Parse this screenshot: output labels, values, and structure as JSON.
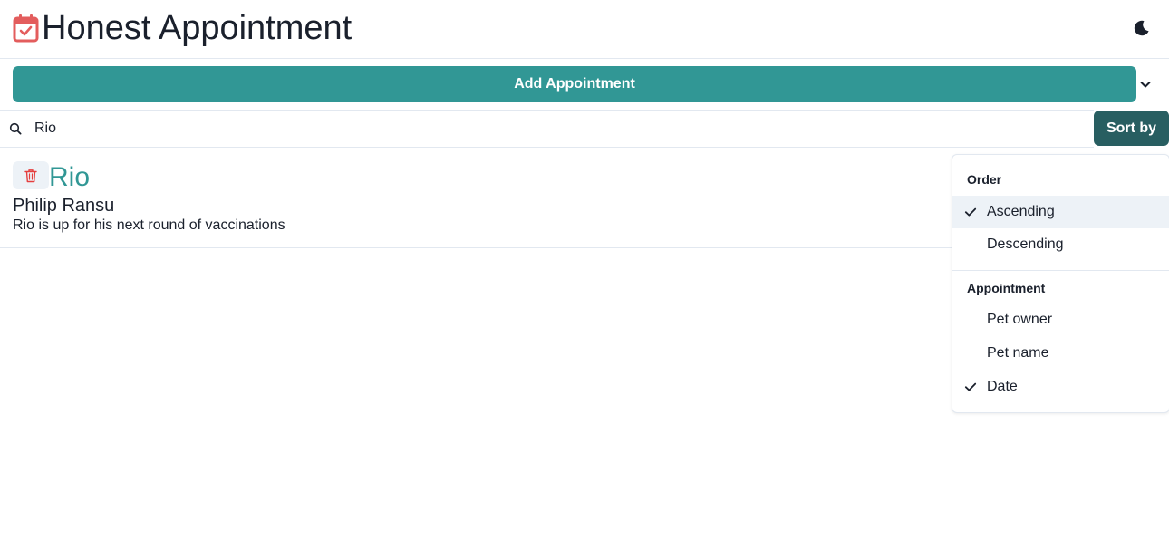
{
  "header": {
    "title": "Honest Appointment",
    "logo_icon": "calendar-check-icon",
    "theme_icon": "moon-icon"
  },
  "toolbar": {
    "add_label": "Add Appointment",
    "expand_icon": "chevron-down-icon"
  },
  "search": {
    "icon": "search-icon",
    "value": "Rio",
    "sort_label": "Sort by"
  },
  "appointments": [
    {
      "pet_name": "Rio",
      "owner_name": "Philip Ransu",
      "notes": "Rio is up for his next round of vaccinations",
      "delete_icon": "trash-icon"
    }
  ],
  "sort_menu": {
    "order": {
      "title": "Order",
      "options": [
        {
          "label": "Ascending",
          "checked": true
        },
        {
          "label": "Descending",
          "checked": false
        }
      ]
    },
    "appointment": {
      "title": "Appointment",
      "options": [
        {
          "label": "Pet owner",
          "checked": false
        },
        {
          "label": "Pet name",
          "checked": false
        },
        {
          "label": "Date",
          "checked": true
        }
      ]
    }
  },
  "colors": {
    "accent": "#319795",
    "accent_dark": "#285e61",
    "logo": "#e35d5d",
    "delete_icon": "#e53e3e",
    "hover_bg": "#edf2f7",
    "border": "#e2e8f0"
  }
}
